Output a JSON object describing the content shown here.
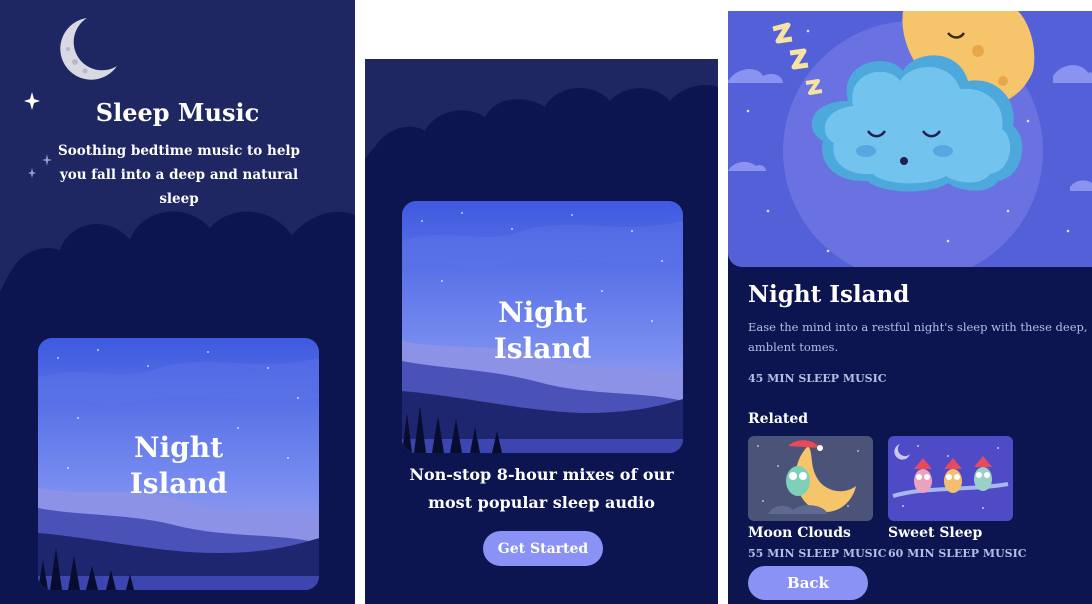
{
  "welcome": {
    "title": "Sleep Music",
    "subtitle": "Soothing bedtime music to help you fall into a deep and natural sleep",
    "card_title_line1": "Night",
    "card_title_line2": "Island"
  },
  "onboarding": {
    "card_title_line1": "Night",
    "card_title_line2": "Island",
    "description": "Non-stop 8-hour mixes of our most popular sleep audio",
    "cta_label": "Get Started"
  },
  "detail": {
    "title": "Night Island",
    "description": "Ease the mind into a restful night's sleep with these deep, amblent tomes.",
    "meta": "45 MIN SLEEP MUSIC",
    "related_heading": "Related",
    "related": [
      {
        "name": "Moon Clouds",
        "meta": "55 MIN SLEEP MUSIC"
      },
      {
        "name": "Sweet Sleep",
        "meta": "60 MIN SLEEP MUSIC"
      }
    ],
    "back_label": "Back"
  },
  "colors": {
    "background": "#0c1550",
    "accent": "#8a93f5",
    "muted_text": "#b8bde6"
  },
  "icons": [
    "moon-icon",
    "sparkle-icon"
  ]
}
